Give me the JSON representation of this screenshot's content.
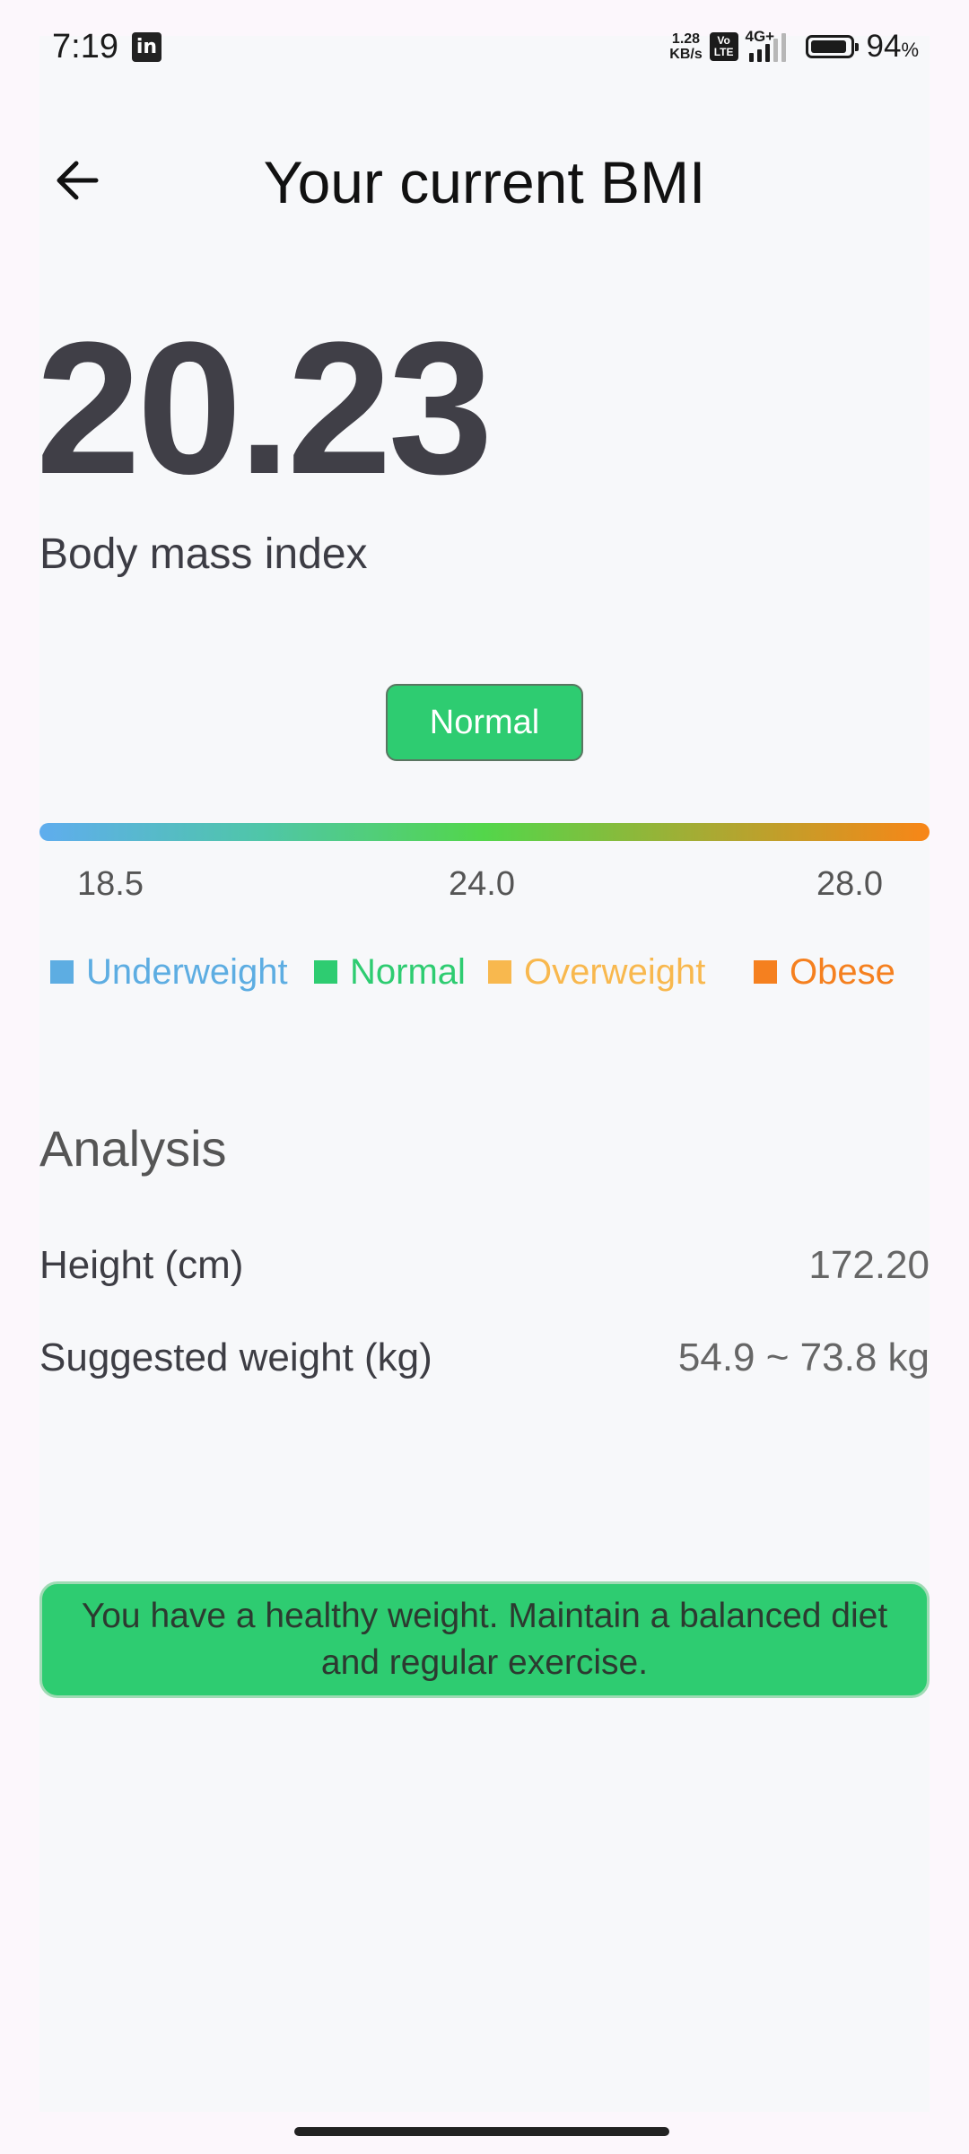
{
  "status_bar": {
    "time": "7:19",
    "app_icon": "linkedin-icon",
    "app_icon_text": "in",
    "net_speed_value": "1.28",
    "net_speed_unit": "KB/s",
    "volte_top": "Vo",
    "volte_bottom": "LTE",
    "network_type": "4G+",
    "battery_level": 0.94,
    "battery_percent": "94",
    "battery_percent_sign": "%"
  },
  "header": {
    "back_icon": "arrow-left-icon",
    "title": "Your current BMI"
  },
  "bmi": {
    "value": "20.23",
    "caption": "Body mass index",
    "category": "Normal"
  },
  "gauge": {
    "colors": [
      "#5fadee",
      "#4fc6a8",
      "#53d64a",
      "#a8aa33",
      "#f88617"
    ],
    "ticks": [
      "18.5",
      "24.0",
      "28.0"
    ]
  },
  "legend": [
    {
      "label": "Underweight",
      "color": "#5dade2"
    },
    {
      "label": "Normal",
      "color": "#2ecc71"
    },
    {
      "label": "Overweight",
      "color": "#f8b84e"
    },
    {
      "label": "Obese",
      "color": "#f5801f"
    }
  ],
  "analysis": {
    "title": "Analysis",
    "rows": [
      {
        "label": "Height (cm)",
        "value": "172.20"
      },
      {
        "label": "Suggested weight (kg)",
        "value": "54.9 ~ 73.8 kg"
      }
    ]
  },
  "advice": {
    "text": "You have a healthy weight. Maintain a balanced diet and regular exercise.",
    "color": "#2ecc71"
  }
}
